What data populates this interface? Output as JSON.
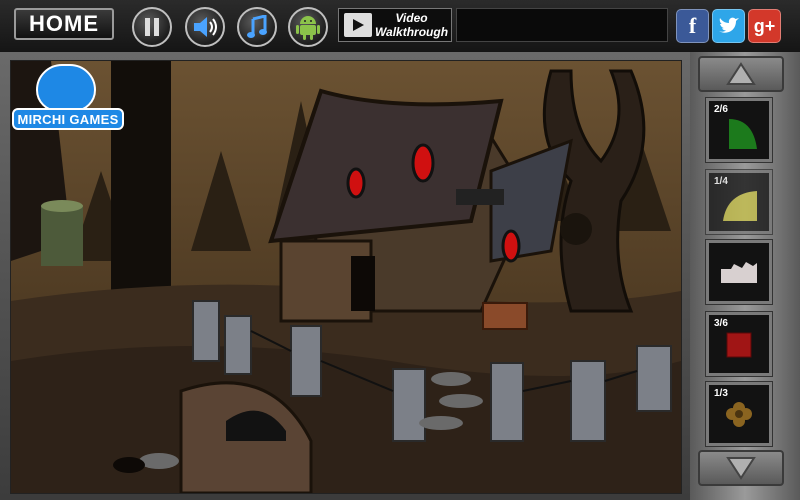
{
  "toolbar": {
    "home_label": "HOME",
    "video_line1": "Video",
    "video_line2": "Walkthrough"
  },
  "logo": {
    "text": "MIRCHI GAMES"
  },
  "social": {
    "facebook": "f",
    "twitter": "t",
    "googleplus": "g+"
  },
  "inventory": [
    {
      "count": "2/6",
      "item": "green-quarter-disc"
    },
    {
      "count": "1/4",
      "item": "yellow-quarter-disc"
    },
    {
      "count": "",
      "item": "stone-fragment"
    },
    {
      "count": "3/6",
      "item": "red-square-tile"
    },
    {
      "count": "1/3",
      "item": "brown-flower"
    }
  ],
  "colors": {
    "brand_blue": "#1e88e5",
    "facebook": "#3b5998",
    "twitter": "#2ea6e9",
    "googleplus": "#d3382a",
    "house_window_glow": "#d01010"
  }
}
